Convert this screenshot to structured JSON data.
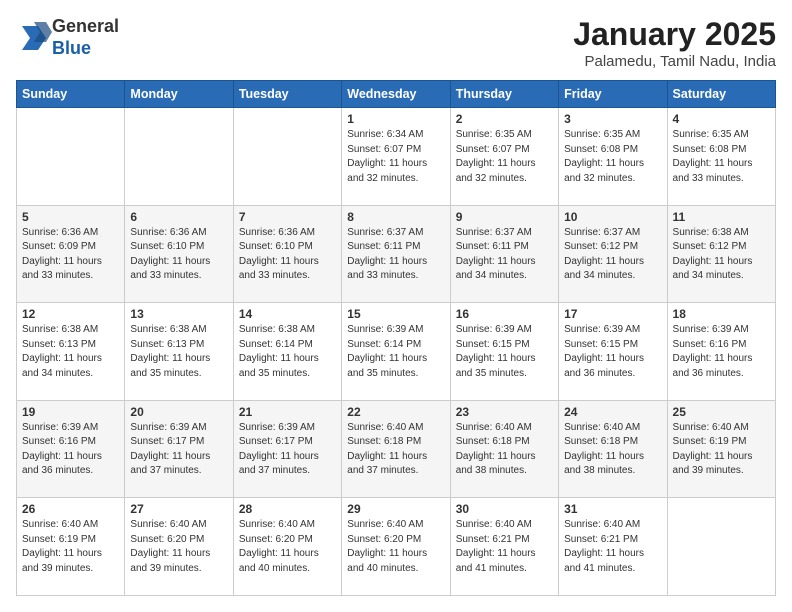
{
  "header": {
    "logo_line1": "General",
    "logo_line2": "Blue",
    "month_title": "January 2025",
    "location": "Palamedu, Tamil Nadu, India"
  },
  "days_of_week": [
    "Sunday",
    "Monday",
    "Tuesday",
    "Wednesday",
    "Thursday",
    "Friday",
    "Saturday"
  ],
  "weeks": [
    [
      {
        "day": "",
        "content": ""
      },
      {
        "day": "",
        "content": ""
      },
      {
        "day": "",
        "content": ""
      },
      {
        "day": "1",
        "content": "Sunrise: 6:34 AM\nSunset: 6:07 PM\nDaylight: 11 hours\nand 32 minutes."
      },
      {
        "day": "2",
        "content": "Sunrise: 6:35 AM\nSunset: 6:07 PM\nDaylight: 11 hours\nand 32 minutes."
      },
      {
        "day": "3",
        "content": "Sunrise: 6:35 AM\nSunset: 6:08 PM\nDaylight: 11 hours\nand 32 minutes."
      },
      {
        "day": "4",
        "content": "Sunrise: 6:35 AM\nSunset: 6:08 PM\nDaylight: 11 hours\nand 33 minutes."
      }
    ],
    [
      {
        "day": "5",
        "content": "Sunrise: 6:36 AM\nSunset: 6:09 PM\nDaylight: 11 hours\nand 33 minutes."
      },
      {
        "day": "6",
        "content": "Sunrise: 6:36 AM\nSunset: 6:10 PM\nDaylight: 11 hours\nand 33 minutes."
      },
      {
        "day": "7",
        "content": "Sunrise: 6:36 AM\nSunset: 6:10 PM\nDaylight: 11 hours\nand 33 minutes."
      },
      {
        "day": "8",
        "content": "Sunrise: 6:37 AM\nSunset: 6:11 PM\nDaylight: 11 hours\nand 33 minutes."
      },
      {
        "day": "9",
        "content": "Sunrise: 6:37 AM\nSunset: 6:11 PM\nDaylight: 11 hours\nand 34 minutes."
      },
      {
        "day": "10",
        "content": "Sunrise: 6:37 AM\nSunset: 6:12 PM\nDaylight: 11 hours\nand 34 minutes."
      },
      {
        "day": "11",
        "content": "Sunrise: 6:38 AM\nSunset: 6:12 PM\nDaylight: 11 hours\nand 34 minutes."
      }
    ],
    [
      {
        "day": "12",
        "content": "Sunrise: 6:38 AM\nSunset: 6:13 PM\nDaylight: 11 hours\nand 34 minutes."
      },
      {
        "day": "13",
        "content": "Sunrise: 6:38 AM\nSunset: 6:13 PM\nDaylight: 11 hours\nand 35 minutes."
      },
      {
        "day": "14",
        "content": "Sunrise: 6:38 AM\nSunset: 6:14 PM\nDaylight: 11 hours\nand 35 minutes."
      },
      {
        "day": "15",
        "content": "Sunrise: 6:39 AM\nSunset: 6:14 PM\nDaylight: 11 hours\nand 35 minutes."
      },
      {
        "day": "16",
        "content": "Sunrise: 6:39 AM\nSunset: 6:15 PM\nDaylight: 11 hours\nand 35 minutes."
      },
      {
        "day": "17",
        "content": "Sunrise: 6:39 AM\nSunset: 6:15 PM\nDaylight: 11 hours\nand 36 minutes."
      },
      {
        "day": "18",
        "content": "Sunrise: 6:39 AM\nSunset: 6:16 PM\nDaylight: 11 hours\nand 36 minutes."
      }
    ],
    [
      {
        "day": "19",
        "content": "Sunrise: 6:39 AM\nSunset: 6:16 PM\nDaylight: 11 hours\nand 36 minutes."
      },
      {
        "day": "20",
        "content": "Sunrise: 6:39 AM\nSunset: 6:17 PM\nDaylight: 11 hours\nand 37 minutes."
      },
      {
        "day": "21",
        "content": "Sunrise: 6:39 AM\nSunset: 6:17 PM\nDaylight: 11 hours\nand 37 minutes."
      },
      {
        "day": "22",
        "content": "Sunrise: 6:40 AM\nSunset: 6:18 PM\nDaylight: 11 hours\nand 37 minutes."
      },
      {
        "day": "23",
        "content": "Sunrise: 6:40 AM\nSunset: 6:18 PM\nDaylight: 11 hours\nand 38 minutes."
      },
      {
        "day": "24",
        "content": "Sunrise: 6:40 AM\nSunset: 6:18 PM\nDaylight: 11 hours\nand 38 minutes."
      },
      {
        "day": "25",
        "content": "Sunrise: 6:40 AM\nSunset: 6:19 PM\nDaylight: 11 hours\nand 39 minutes."
      }
    ],
    [
      {
        "day": "26",
        "content": "Sunrise: 6:40 AM\nSunset: 6:19 PM\nDaylight: 11 hours\nand 39 minutes."
      },
      {
        "day": "27",
        "content": "Sunrise: 6:40 AM\nSunset: 6:20 PM\nDaylight: 11 hours\nand 39 minutes."
      },
      {
        "day": "28",
        "content": "Sunrise: 6:40 AM\nSunset: 6:20 PM\nDaylight: 11 hours\nand 40 minutes."
      },
      {
        "day": "29",
        "content": "Sunrise: 6:40 AM\nSunset: 6:20 PM\nDaylight: 11 hours\nand 40 minutes."
      },
      {
        "day": "30",
        "content": "Sunrise: 6:40 AM\nSunset: 6:21 PM\nDaylight: 11 hours\nand 41 minutes."
      },
      {
        "day": "31",
        "content": "Sunrise: 6:40 AM\nSunset: 6:21 PM\nDaylight: 11 hours\nand 41 minutes."
      },
      {
        "day": "",
        "content": ""
      }
    ]
  ]
}
